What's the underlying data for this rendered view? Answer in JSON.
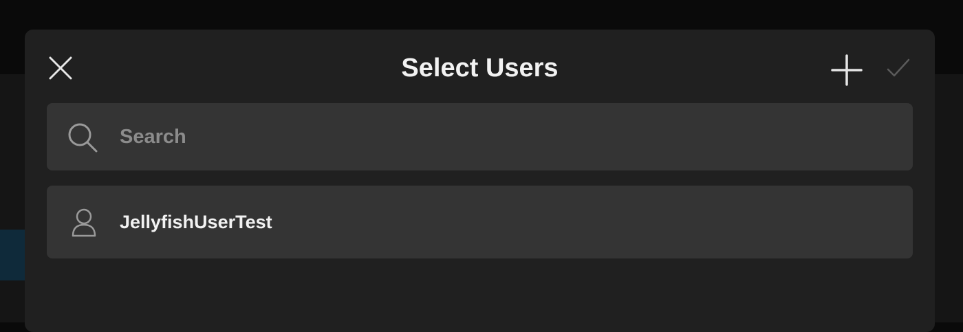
{
  "dialog": {
    "title": "Select Users",
    "close_icon": "close-icon",
    "add_icon": "plus-icon",
    "confirm_icon": "checkmark-icon"
  },
  "search": {
    "placeholder": "Search",
    "value": "",
    "icon": "search-icon"
  },
  "users": [
    {
      "name": "JellyfishUserTest",
      "icon": "user-icon"
    }
  ],
  "colors": {
    "modal_background": "#202020",
    "row_background": "#343434",
    "text_primary": "#f2f2f2",
    "text_placeholder": "#8c8c8c",
    "icon_color": "#e6e6e6",
    "disabled_icon_color": "#5a5a5a"
  }
}
